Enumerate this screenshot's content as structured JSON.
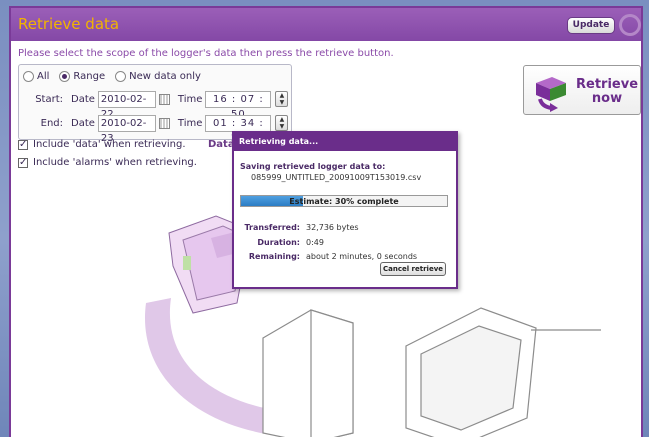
{
  "header": {
    "title": "Retrieve data",
    "update_label": "Update"
  },
  "instruction": "Please select the scope of the logger's data then press the retrieve button.",
  "scope": {
    "options": [
      {
        "label": "All",
        "selected": false
      },
      {
        "label": "Range",
        "selected": true
      },
      {
        "label": "New data only",
        "selected": false
      }
    ],
    "start": {
      "label": "Start:",
      "date_label": "Date",
      "date": "2010-02-22",
      "time_label": "Time",
      "time": "16 : 07 : 50"
    },
    "end": {
      "label": "End:",
      "date_label": "Date",
      "date": "2010-02-23",
      "time_label": "Time",
      "time": "01 : 34 : 25"
    }
  },
  "checks": {
    "include_data": {
      "label": "Include 'data' when retrieving.",
      "checked": true
    },
    "include_alarms": {
      "label": "Include 'alarms' when retrieving.",
      "checked": true
    },
    "data_label": "Data"
  },
  "retrieve_button": {
    "line1": "Retrieve",
    "line2": "now"
  },
  "dialog": {
    "title": "Retrieving data...",
    "saving_label": "Saving retrieved logger data to:",
    "filename": "085999_UNTITLED_20091009T153019.csv",
    "progress_text": "Estimate: 30% complete",
    "progress_fraction": 0.3,
    "transferred_label": "Transferred:",
    "transferred_value": "32,736 bytes",
    "duration_label": "Duration:",
    "duration_value": "0:49",
    "remaining_label": "Remaining:",
    "remaining_value": "about 2 minutes, 0 seconds",
    "cancel_label": "Cancel retrieve"
  },
  "colors": {
    "accent": "#8448a6",
    "title_text": "#f2b400",
    "progress": "#2b7cc4"
  }
}
